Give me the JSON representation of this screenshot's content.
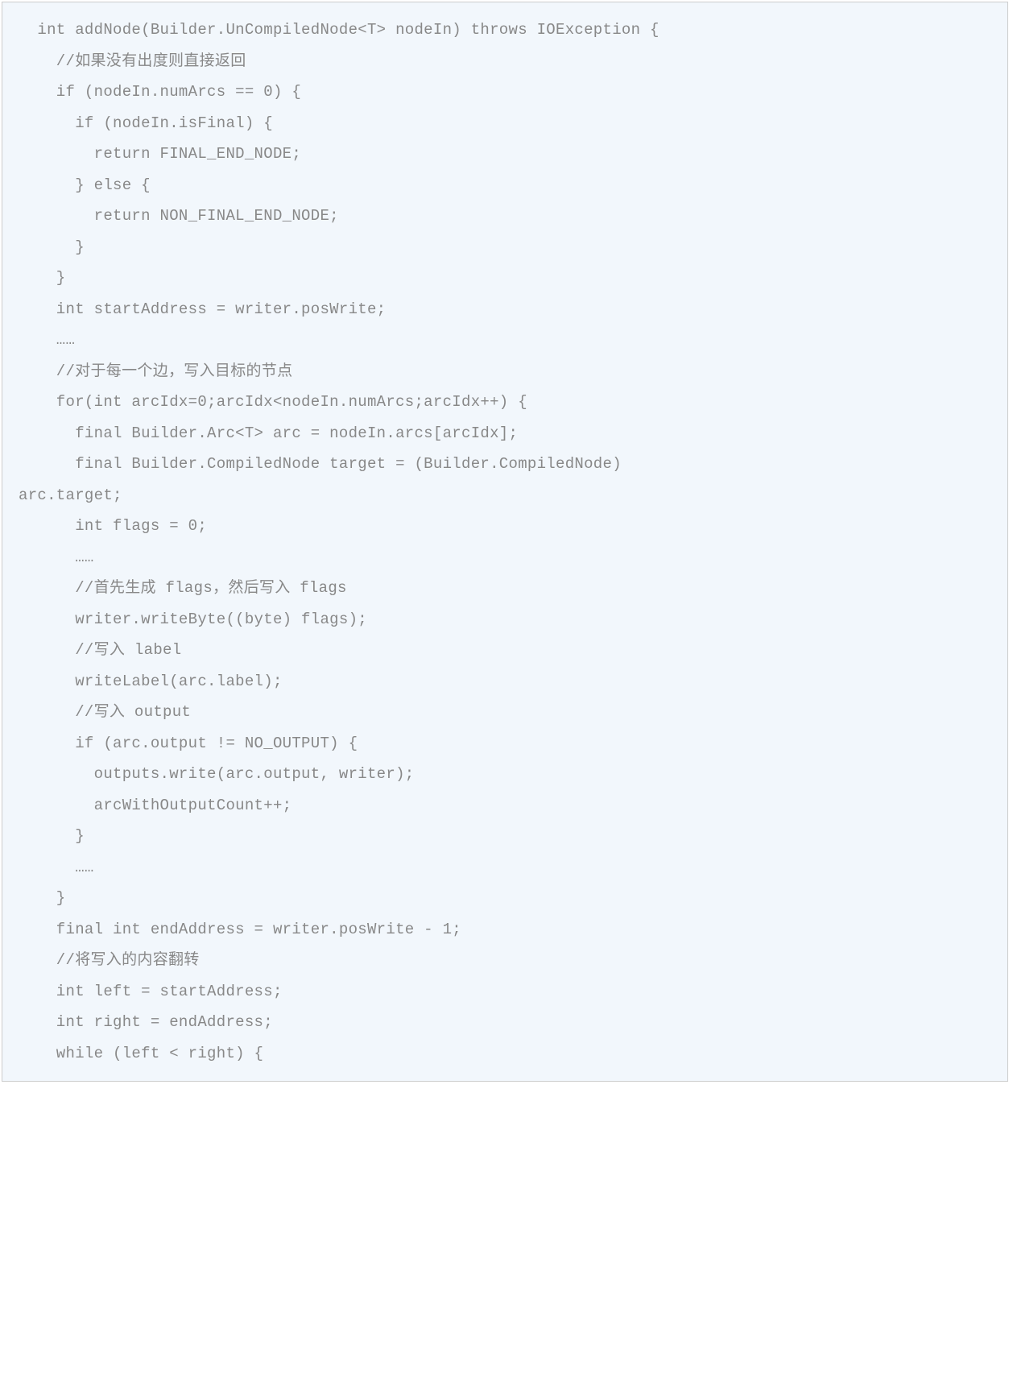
{
  "code_lines": [
    "  int addNode(Builder.UnCompiledNode<T> nodeIn) throws IOException {",
    "    //如果没有出度则直接返回",
    "    if (nodeIn.numArcs == 0) {",
    "      if (nodeIn.isFinal) {",
    "        return FINAL_END_NODE;",
    "      } else {",
    "        return NON_FINAL_END_NODE;",
    "      }",
    "    }",
    "",
    "    int startAddress = writer.posWrite;",
    "    ……",
    "    //对于每一个边，写入目标的节点",
    "    for(int arcIdx=0;arcIdx<nodeIn.numArcs;arcIdx++) {",
    "      final Builder.Arc<T> arc = nodeIn.arcs[arcIdx];",
    "      final Builder.CompiledNode target = (Builder.CompiledNode) ",
    "arc.target;",
    "      int flags = 0;",
    "      ……",
    "      //首先生成 flags，然后写入 flags",
    "      writer.writeByte((byte) flags);",
    "      //写入 label",
    "      writeLabel(arc.label);",
    "      //写入 output",
    "      if (arc.output != NO_OUTPUT) {",
    "        outputs.write(arc.output, writer);",
    "        arcWithOutputCount++;",
    "      }",
    "      ……",
    "    }",
    "",
    "    final int endAddress = writer.posWrite - 1;",
    "    //将写入的内容翻转",
    "    int left = startAddress;",
    "    int right = endAddress;",
    "    while (left < right) {"
  ]
}
